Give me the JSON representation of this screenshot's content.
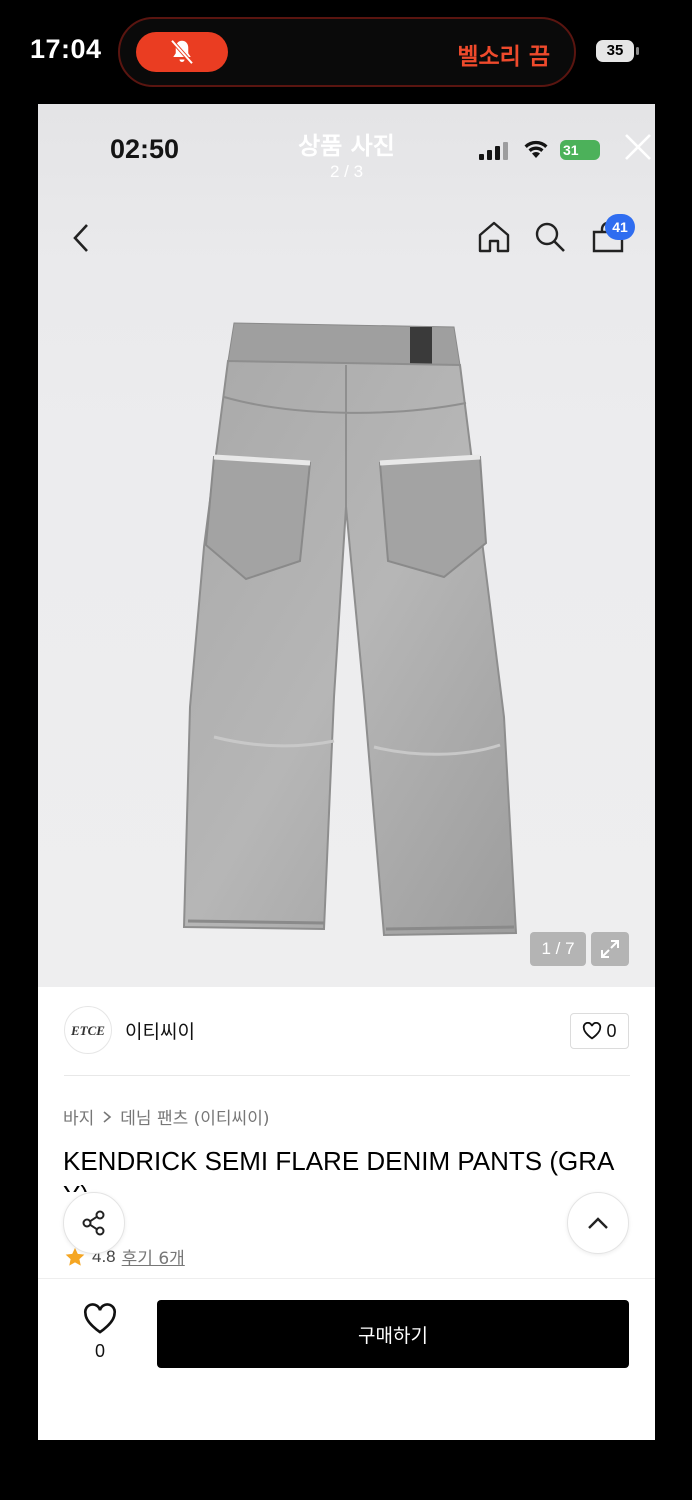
{
  "phone_status": {
    "time": "17:04",
    "ringer_text": "벨소리 끔",
    "battery": "35",
    "icons": [
      "bell-slash-icon",
      "battery-icon"
    ]
  },
  "screenshot_status": {
    "time": "02:50",
    "battery": "31"
  },
  "viewer": {
    "title": "상품 사진",
    "counter": "2 / 3"
  },
  "nav": {
    "cart_count": "41",
    "icons": [
      "back-icon",
      "home-icon",
      "search-icon",
      "cart-icon"
    ]
  },
  "gallery": {
    "counter": "1 / 7",
    "product_color": "gray denim"
  },
  "brand": {
    "logo_text": "ETCE",
    "name": "이티씨이",
    "like_count": "0"
  },
  "product": {
    "breadcrumb": [
      "바지",
      "데님 팬츠 (이티씨이)"
    ],
    "title": "KENDRICK SEMI FLARE DENIM PANTS (GRAY)",
    "rating": "4.8",
    "review_text": "후기 6개"
  },
  "bottom_bar": {
    "wish_count": "0",
    "buy_label": "구매하기"
  },
  "colors": {
    "accent_red": "#ea3d22",
    "badge_blue": "#2f6df0",
    "star": "#f5a623",
    "buy_button": "#000000"
  }
}
